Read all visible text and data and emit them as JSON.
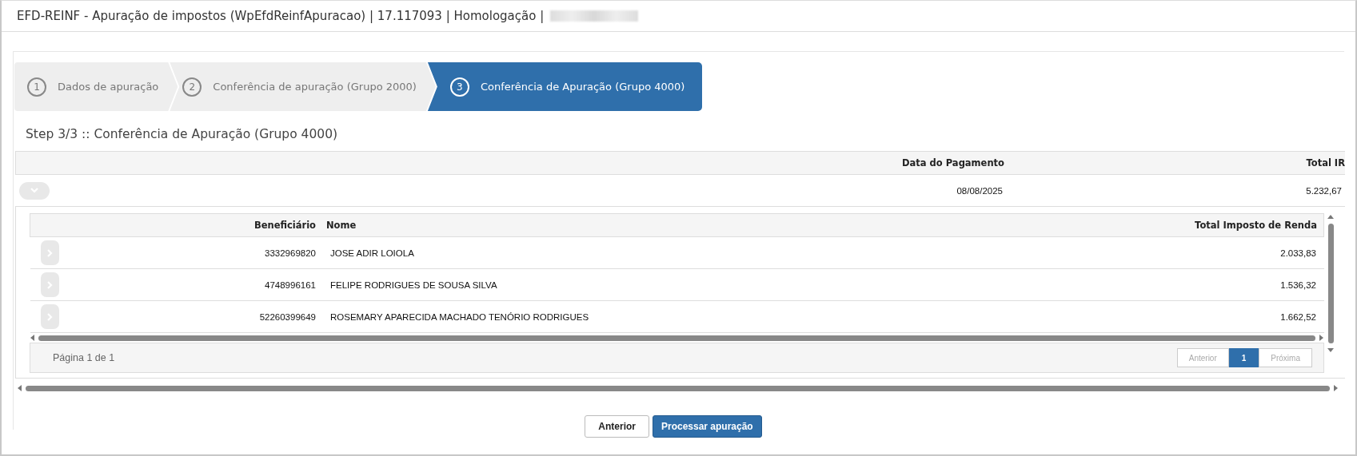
{
  "window": {
    "title": "EFD-REINF - Apuração de impostos (WpEfdReinfApuracao) | 17.117093 | Homologação |"
  },
  "stepper": [
    {
      "number": "1",
      "label": "Dados de apuração",
      "selected": false
    },
    {
      "number": "2",
      "label": "Conferência de apuração (Grupo 2000)",
      "selected": false
    },
    {
      "number": "3",
      "label": "Conferência de Apuração (Grupo 4000)",
      "selected": true
    }
  ],
  "heading": "Step 3/3 :: Conferência de Apuração (Grupo 4000)",
  "table": {
    "columns": [
      "Data do Pagamento",
      "Total IR"
    ],
    "rows": [
      {
        "expanded": true,
        "date": "08/08/2025",
        "total": "5.232,67",
        "detail": {
          "columns": [
            "Beneficiário",
            "Nome",
            "Total Imposto de Renda"
          ],
          "rows": [
            {
              "expanded": false,
              "id": "3332969820",
              "name": "JOSE ADIR LOIOLA",
              "total": "2.033,83"
            },
            {
              "expanded": false,
              "id": "4748996161",
              "name": "FELIPE RODRIGUES DE SOUSA SILVA",
              "total": "1.536,32"
            },
            {
              "expanded": false,
              "id": "52260399649",
              "name": "ROSEMARY APARECIDA MACHADO TENÓRIO RODRIGUES",
              "total": "1.662,52"
            }
          ],
          "pagination": {
            "summary": "Página 1 de 1",
            "previous": {
              "label": "Anterior",
              "disabled": true
            },
            "pages": [
              {
                "label": "1",
                "selected": true
              }
            ],
            "next": {
              "label": "Próxima",
              "disabled": true
            }
          }
        }
      }
    ]
  },
  "buttons": [
    {
      "label": "Anterior",
      "kind": "secondary"
    },
    {
      "label": "Processar apuração",
      "kind": "primary"
    }
  ]
}
